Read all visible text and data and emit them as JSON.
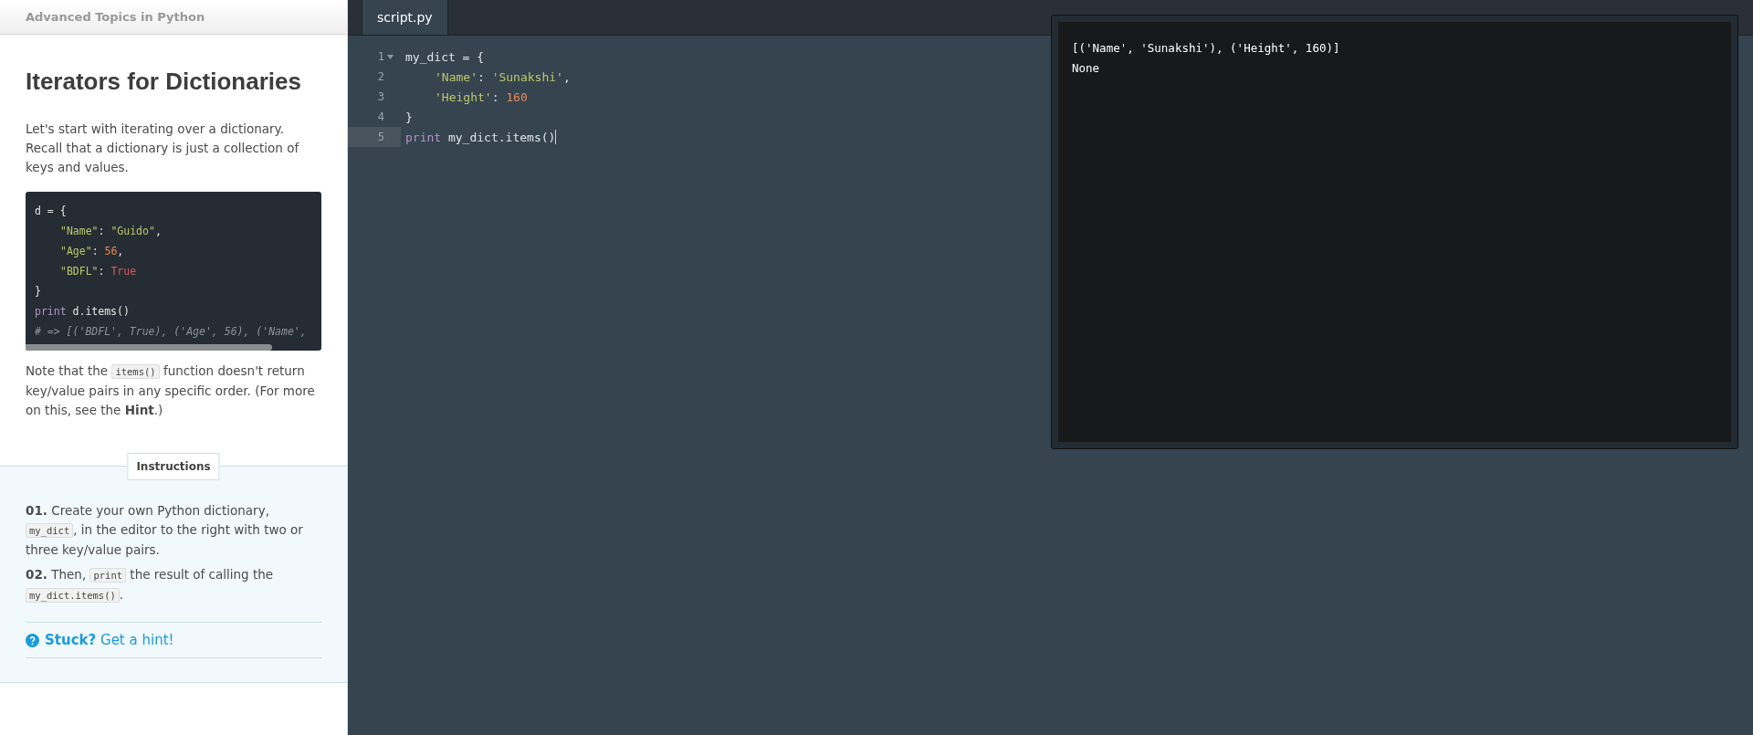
{
  "lesson": {
    "course_title": "Advanced Topics in Python",
    "title": "Iterators for Dictionaries",
    "intro": "Let's start with iterating over a dictionary. Recall that a dictionary is just a collection of keys and values.",
    "example_code": [
      {
        "indented": false,
        "tokens": [
          {
            "kind": "plain",
            "text": "d = {"
          }
        ]
      },
      {
        "indented": true,
        "tokens": [
          {
            "kind": "string",
            "text": "\"Name\""
          },
          {
            "kind": "plain",
            "text": ": "
          },
          {
            "kind": "string",
            "text": "\"Guido\""
          },
          {
            "kind": "plain",
            "text": ","
          }
        ]
      },
      {
        "indented": true,
        "tokens": [
          {
            "kind": "string",
            "text": "\"Age\""
          },
          {
            "kind": "plain",
            "text": ": "
          },
          {
            "kind": "number",
            "text": "56"
          },
          {
            "kind": "plain",
            "text": ","
          }
        ]
      },
      {
        "indented": true,
        "tokens": [
          {
            "kind": "string",
            "text": "\"BDFL\""
          },
          {
            "kind": "plain",
            "text": ": "
          },
          {
            "kind": "constant",
            "text": "True"
          }
        ]
      },
      {
        "indented": false,
        "tokens": [
          {
            "kind": "plain",
            "text": "}"
          }
        ]
      },
      {
        "indented": false,
        "tokens": [
          {
            "kind": "keyword",
            "text": "print"
          },
          {
            "kind": "plain",
            "text": " d.items()"
          }
        ]
      },
      {
        "indented": false,
        "tokens": [
          {
            "kind": "comment",
            "text": "# => [('BDFL', True), ('Age', 56), ('Name', "
          }
        ]
      }
    ],
    "note": [
      {
        "kind": "text",
        "text": "Note that the "
      },
      {
        "kind": "code",
        "text": "items()"
      },
      {
        "kind": "text",
        "text": " function doesn't return key/value pairs in any specific order. (For more on this, see the **Hint**.)"
      }
    ]
  },
  "instructions": {
    "label": "Instructions",
    "steps": [
      [
        {
          "kind": "text",
          "text": "**01.** Create your own Python dictionary, "
        },
        {
          "kind": "code",
          "text": "my_dict"
        },
        {
          "kind": "text",
          "text": ", in the editor to the right with two or three key/value pairs."
        }
      ],
      [
        {
          "kind": "text",
          "text": "**02.** Then, "
        },
        {
          "kind": "code",
          "text": "print"
        },
        {
          "kind": "text",
          "text": " the result of calling the "
        },
        {
          "kind": "code",
          "text": "my_dict.items()"
        },
        {
          "kind": "text",
          "text": "."
        }
      ]
    ],
    "hint": "**Stuck?** Get a hint!"
  },
  "editor": {
    "tabs": [
      {
        "label": "script.py",
        "selected": true
      }
    ],
    "lines": [
      {
        "number": "1",
        "foldable": true,
        "active": false,
        "indented": false,
        "tokens": [
          {
            "kind": "plain",
            "text": "my_dict = {"
          }
        ]
      },
      {
        "number": "2",
        "foldable": false,
        "active": false,
        "indented": true,
        "tokens": [
          {
            "kind": "string",
            "text": "'Name'"
          },
          {
            "kind": "plain",
            "text": ": "
          },
          {
            "kind": "string",
            "text": "'Sunakshi'"
          },
          {
            "kind": "plain",
            "text": ","
          }
        ]
      },
      {
        "number": "3",
        "foldable": false,
        "active": false,
        "indented": true,
        "tokens": [
          {
            "kind": "string",
            "text": "'Height'"
          },
          {
            "kind": "plain",
            "text": ": "
          },
          {
            "kind": "number",
            "text": "160"
          }
        ]
      },
      {
        "number": "4",
        "foldable": false,
        "active": false,
        "indented": false,
        "tokens": [
          {
            "kind": "plain",
            "text": "}"
          }
        ]
      },
      {
        "number": "5",
        "foldable": false,
        "active": true,
        "indented": false,
        "tokens": [
          {
            "kind": "keyword",
            "text": "print"
          },
          {
            "kind": "plain",
            "text": " my_dict.items()"
          }
        ]
      }
    ]
  },
  "output": {
    "lines": [
      "[('Name', 'Sunakshi'), ('Height', 160)]",
      "None"
    ]
  }
}
